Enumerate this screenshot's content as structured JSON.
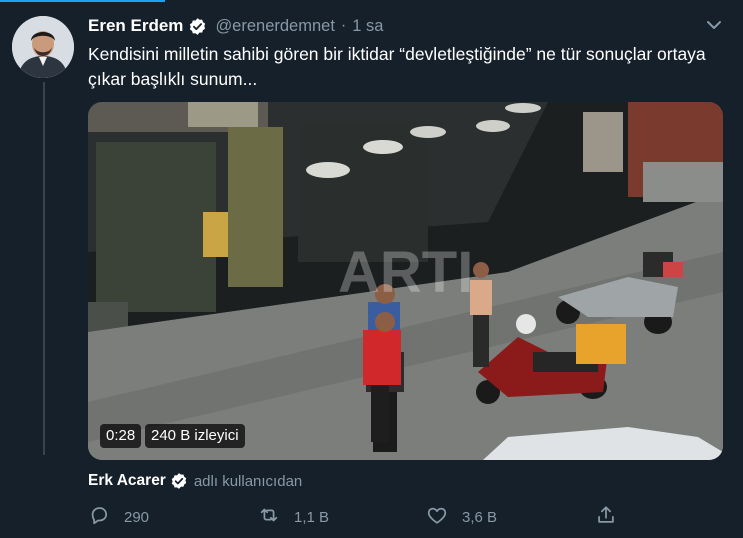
{
  "colors": {
    "background": "#15202b",
    "accent": "#1da1f2",
    "secondary_text": "#8899a6",
    "divider": "#38444d"
  },
  "tweet": {
    "author_name": "Eren Erdem",
    "author_handle": "@erenerdemnet",
    "separator": "·",
    "timestamp": "1 sa",
    "text": "Kendisini milletin sahibi gören bir iktidar “devletleştiğinde” ne tür sonuçlar ortaya çıkar başlıklı sunum...",
    "verified_icon": "verified-badge-icon",
    "menu_icon": "chevron-down-icon"
  },
  "media": {
    "duration": "0:28",
    "views": "240 B izleyici",
    "watermark": "ARTI"
  },
  "attribution": {
    "name": "Erk Acarer",
    "suffix": "adlı kullanıcıdan"
  },
  "actions": {
    "reply_count": "290",
    "retweet_count": "1,1 B",
    "like_count": "3,6 B"
  }
}
